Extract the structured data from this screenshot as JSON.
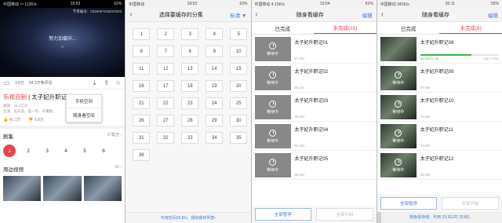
{
  "panel1": {
    "status": {
      "left": "中国移动 ⁴ᴳ 112K/s",
      "time": "19:53",
      "right": "62%"
    },
    "banner": "节目编号：0325097246010303",
    "loading_text": "努力加载中...",
    "sub_text": "8",
    "actions": {
      "count1": "3.6万",
      "count2": "64.3万条评论"
    },
    "title_brand": "乐视自制",
    "title_rest": " | 太子妃升职记 9",
    "meta_line1": "播放：34.2亿次",
    "meta_line2": "主演：张天爱、盛一伦、于朦胧、",
    "likes": "40.1万",
    "dislikes": "6.8万",
    "episodes_title": "剧集",
    "episodes_more": "37集全 ›",
    "episodes": [
      "1",
      "2",
      "3",
      "4",
      "5",
      "6"
    ],
    "nearby_title": "周边视频",
    "nearby_more": "50 ›",
    "popup": {
      "phone": "手机空间",
      "card": "随身看空间"
    }
  },
  "panel2": {
    "title": "选择要缓存的分集",
    "action": "标清 ▼",
    "cells": [
      "1",
      "2",
      "3",
      "4",
      "5",
      "6",
      "7",
      "8",
      "9",
      "10",
      "11",
      "12",
      "13",
      "14",
      "15",
      "16",
      "17",
      "18",
      "19",
      "20",
      "21",
      "22",
      "23",
      "24",
      "25",
      "26",
      "27",
      "28",
      "29",
      "30",
      "31",
      "32",
      "33",
      "34",
      "35",
      "36"
    ],
    "footer": "可用空间29.8G，我的缓存列表›"
  },
  "panel3": {
    "status": {
      "left": "中国移动 4.15K/s",
      "time": "19:54",
      "right": "61%"
    },
    "title": "随身看缓存",
    "edit": "编辑",
    "tab_done": "已完成",
    "tab_pending": "未完成(15)",
    "items": [
      {
        "name": "太子妃升职记01",
        "size": "67.2M",
        "status": "等待中"
      },
      {
        "name": "太子妃升职记02",
        "size": "60.1M",
        "status": "等待中"
      },
      {
        "name": "太子妃升职记03",
        "size": "65.2M",
        "status": "等待中"
      },
      {
        "name": "太子妃升职记04",
        "size": "63.4M",
        "status": "等待中"
      },
      {
        "name": "太子妃升职记05",
        "size": "58.6M",
        "status": "等待中"
      }
    ],
    "btn_pause": "全部暂停",
    "btn_start": "全部开始"
  },
  "panel4": {
    "status": {
      "left": "中国移动 342K/s",
      "time": "20:11",
      "right": "55%"
    },
    "title": "随身看缓存",
    "edit": "编辑",
    "tab_done": "已完成",
    "tab_pending": "未完成(6)",
    "items": [
      {
        "name": "太子妃升职记08",
        "progress_left": "50.0M/76.7M",
        "progress_right": "306.0 KB/s",
        "status": ""
      },
      {
        "name": "太子妃升职记09",
        "size": "67.6M",
        "status": "等待中"
      },
      {
        "name": "太子妃升职记10",
        "size": "76.8M",
        "status": "等待中"
      },
      {
        "name": "太子妃升职记11",
        "size": "70.9M",
        "status": "等待中"
      },
      {
        "name": "太子妃升职记12",
        "size": "36.3M",
        "status": "等待中"
      }
    ],
    "progress_fraction": 0.65,
    "btn_pause": "全部暂停",
    "btn_start": "全部开始",
    "storage": "随身看存储：可用 29.3G/共 29.8G"
  }
}
